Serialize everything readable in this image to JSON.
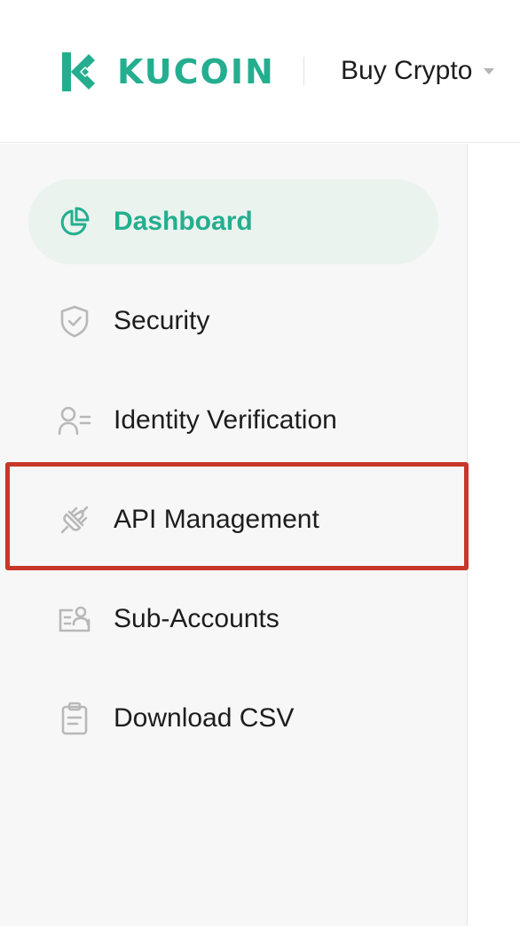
{
  "brand": {
    "name": "KUCOIN",
    "color": "#24ae8f"
  },
  "header": {
    "nav_buy_crypto": "Buy Crypto"
  },
  "sidebar": {
    "items": [
      {
        "label": "Dashboard",
        "icon": "pie-chart-icon",
        "active": true
      },
      {
        "label": "Security",
        "icon": "shield-icon",
        "active": false
      },
      {
        "label": "Identity Verification",
        "icon": "user-id-icon",
        "active": false
      },
      {
        "label": "API Management",
        "icon": "plug-icon",
        "active": false,
        "highlighted": true
      },
      {
        "label": "Sub-Accounts",
        "icon": "sub-accounts-icon",
        "active": false
      },
      {
        "label": "Download CSV",
        "icon": "clipboard-icon",
        "active": false
      }
    ]
  },
  "colors": {
    "accent": "#24ae8f",
    "active_bg": "#ebf3ef",
    "sidebar_bg": "#f7f7f7",
    "highlight": "#c9362a",
    "icon_gray": "#b8b8b8"
  }
}
